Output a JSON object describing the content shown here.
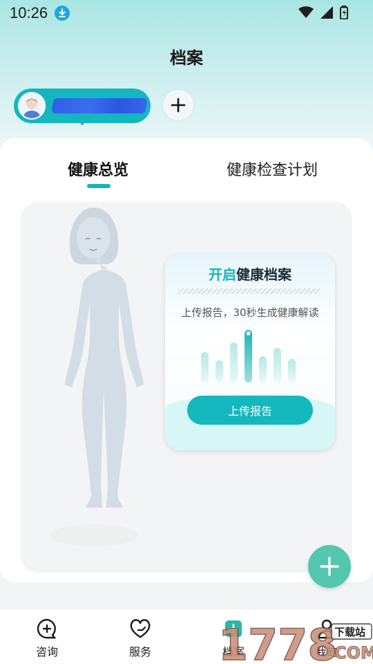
{
  "status_bar": {
    "time": "10:26"
  },
  "header": {
    "title": "档案"
  },
  "tabs": [
    {
      "label": "健康总览",
      "active": true
    },
    {
      "label": "健康检查计划",
      "active": false
    }
  ],
  "cta": {
    "title_highlight": "开启",
    "title_rest": "健康档案",
    "subtitle": "上传报告，30秒生成健康解读",
    "button_label": "上传报告"
  },
  "bottom_nav": [
    {
      "label": "咨询",
      "icon": "chat-plus-icon"
    },
    {
      "label": "服务",
      "icon": "heart-hands-icon"
    },
    {
      "label": "档案",
      "icon": "folder-icon",
      "active": true
    },
    {
      "label": "我的",
      "icon": "person-icon"
    }
  ],
  "watermark": {
    "text": "1778",
    "site": "下载站",
    "suffix": "COM"
  },
  "colors": {
    "accent": "#14b7bd",
    "fab": "#52c7ad",
    "scribble": "#2f5fe6"
  }
}
